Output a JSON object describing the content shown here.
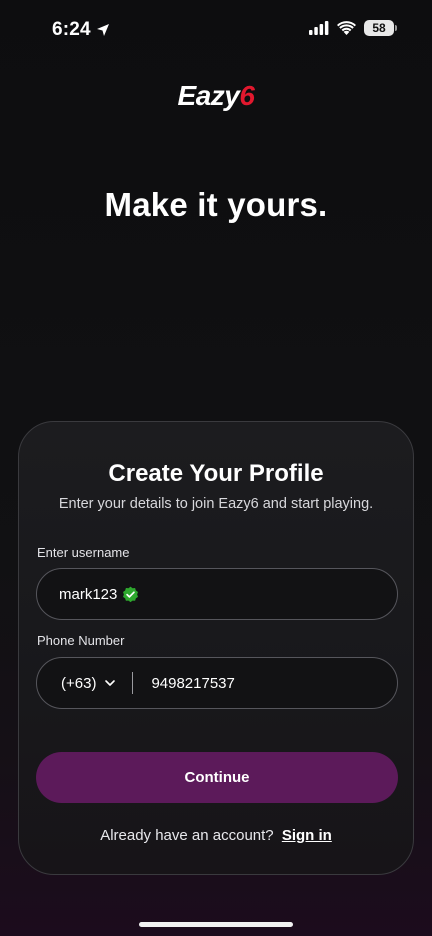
{
  "status_bar": {
    "time": "6:24",
    "battery": "58"
  },
  "brand": {
    "logo_main": "Eazy",
    "logo_accent": "6",
    "accent_color": "#e1182e"
  },
  "hero": {
    "title": "Make it yours."
  },
  "profile_card": {
    "title": "Create Your Profile",
    "subtitle": "Enter your details to join Eazy6 and start playing.",
    "username_label": "Enter username",
    "username_value": "mark123",
    "username_status_icon": "verified-check-icon",
    "phone_label": "Phone Number",
    "country_code": "(+63)",
    "phone_value": "9498217537",
    "continue_label": "Continue",
    "button_color": "#5c1a5a",
    "signin_prompt": "Already have an account?",
    "signin_link": "Sign in"
  }
}
